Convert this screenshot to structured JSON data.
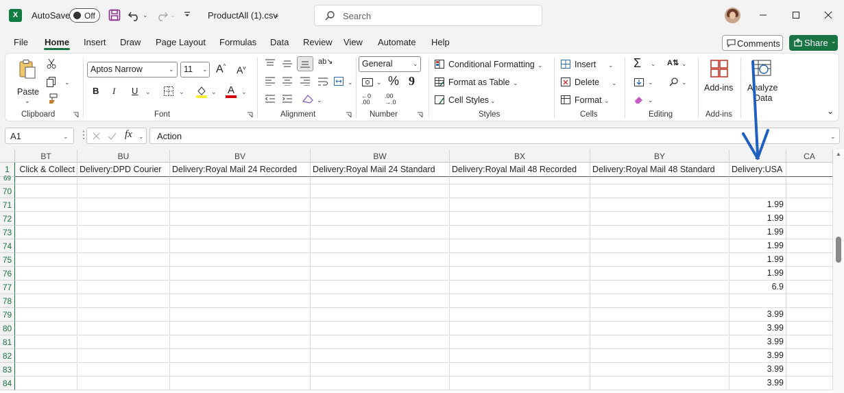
{
  "titlebar": {
    "autosave_label": "AutoSave",
    "autosave_state": "Off",
    "filename": "ProductAll (1).csv",
    "search_placeholder": "Search"
  },
  "menu": {
    "tabs": [
      "File",
      "Home",
      "Insert",
      "Draw",
      "Page Layout",
      "Formulas",
      "Data",
      "Review",
      "View",
      "Automate",
      "Help"
    ],
    "active": "Home",
    "comments_label": "Comments",
    "share_label": "Share"
  },
  "ribbon": {
    "clipboard": {
      "paste": "Paste",
      "label": "Clipboard"
    },
    "font": {
      "name": "Aptos Narrow",
      "size": "11",
      "label": "Font",
      "bold": "B",
      "italic": "I",
      "underline": "U"
    },
    "alignment": {
      "label": "Alignment"
    },
    "number": {
      "format": "General",
      "label": "Number",
      "percent": "%",
      "comma": "9"
    },
    "styles": {
      "conditional": "Conditional Formatting",
      "format_table": "Format as Table",
      "cell_styles": "Cell Styles",
      "label": "Styles"
    },
    "cells": {
      "insert": "Insert",
      "delete": "Delete",
      "format": "Format",
      "label": "Cells"
    },
    "editing": {
      "label": "Editing"
    },
    "addins": {
      "button": "Add-ins",
      "label": "Add-ins"
    },
    "analyze": {
      "line1": "Analyze",
      "line2": "Data"
    }
  },
  "formula_bar": {
    "name_box": "A1",
    "fx": "fx",
    "content": "Action"
  },
  "grid": {
    "columns": [
      "BT",
      "BU",
      "BV",
      "BW",
      "BX",
      "BY",
      "Z",
      "CA"
    ],
    "header_row_number": "1",
    "header_row": [
      "Click & Collect",
      "Delivery:DPD Courier",
      "Delivery:Royal Mail 24 Recorded",
      "Delivery:Royal Mail 24 Standard",
      "Delivery:Royal Mail 48 Recorded",
      "Delivery:Royal Mail 48 Standard",
      "Delivery:USA",
      ""
    ],
    "partial_row": "69",
    "rows": [
      {
        "n": "70",
        "usa": ""
      },
      {
        "n": "71",
        "usa": "1.99"
      },
      {
        "n": "72",
        "usa": "1.99"
      },
      {
        "n": "73",
        "usa": "1.99"
      },
      {
        "n": "74",
        "usa": "1.99"
      },
      {
        "n": "75",
        "usa": "1.99"
      },
      {
        "n": "76",
        "usa": "1.99"
      },
      {
        "n": "77",
        "usa": "6.9"
      },
      {
        "n": "78",
        "usa": ""
      },
      {
        "n": "79",
        "usa": "3.99"
      },
      {
        "n": "80",
        "usa": "3.99"
      },
      {
        "n": "81",
        "usa": "3.99"
      },
      {
        "n": "82",
        "usa": "3.99"
      },
      {
        "n": "83",
        "usa": "3.99"
      },
      {
        "n": "84",
        "usa": "3.99"
      }
    ]
  },
  "colors": {
    "excel_green": "#1a7343",
    "annotation_arrow": "#1f5fbf"
  }
}
